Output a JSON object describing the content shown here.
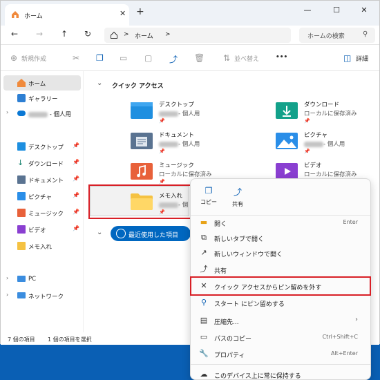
{
  "tab": {
    "title": "ホーム",
    "close": "✕",
    "new": "+"
  },
  "window_controls": {
    "min": "—",
    "max": "☐",
    "close": "✕"
  },
  "nav": {
    "back": "←",
    "forward": "→",
    "up": "↑",
    "refresh": "↻"
  },
  "address": {
    "sep1": ">",
    "crumb": "ホーム",
    "sep2": ">"
  },
  "search": {
    "placeholder": "ホームの検索"
  },
  "toolbar": {
    "new": "新規作成",
    "sort": "並べ替え",
    "more": "•••",
    "details": "詳細"
  },
  "sidebar": {
    "items": [
      {
        "label": "ホーム"
      },
      {
        "label": "ギャラリー"
      },
      {
        "label": "- 個人用"
      },
      {
        "label": "デスクトップ"
      },
      {
        "label": "ダウンロード"
      },
      {
        "label": "ドキュメント"
      },
      {
        "label": "ピクチャ"
      },
      {
        "label": "ミュージック"
      },
      {
        "label": "ビデオ"
      },
      {
        "label": "メモ入れ"
      },
      {
        "label": "PC"
      },
      {
        "label": "ネットワーク"
      }
    ]
  },
  "quick_access": {
    "title": "クイック アクセス",
    "folders": [
      {
        "name": "デスクトップ",
        "sub": "- 個人用"
      },
      {
        "name": "ダウンロード",
        "sub": "ローカルに保存済み"
      },
      {
        "name": "ドキュメント",
        "sub": "- 個人用"
      },
      {
        "name": "ピクチャ",
        "sub": "- 個人用"
      },
      {
        "name": "ミュージック",
        "sub": "ローカルに保存済み"
      },
      {
        "name": "ビデオ",
        "sub": "ローカルに保存済み"
      },
      {
        "name": "メモ入れ",
        "sub": "- 個"
      }
    ]
  },
  "recent": {
    "label": "最近使用した項目"
  },
  "status": {
    "count": "7 個の項目",
    "selected": "1 個の項目を選択"
  },
  "context_menu": {
    "copy": "コピー",
    "share_top": "共有",
    "items": [
      {
        "label": "開く",
        "shortcut": "Enter"
      },
      {
        "label": "新しいタブで開く",
        "shortcut": ""
      },
      {
        "label": "新しいウィンドウで開く",
        "shortcut": ""
      },
      {
        "label": "共有",
        "shortcut": ""
      },
      {
        "label": "クイック アクセスからピン留めを外す",
        "shortcut": ""
      },
      {
        "label": "スタート にピン留めする",
        "shortcut": ""
      },
      {
        "label": "圧縮先...",
        "shortcut": ""
      },
      {
        "label": "パスのコピー",
        "shortcut": "Ctrl+Shift+C"
      },
      {
        "label": "プロパティ",
        "shortcut": "Alt+Enter"
      },
      {
        "label": "このデバイス上に常に保持する",
        "shortcut": ""
      }
    ]
  },
  "colors": {
    "accent": "#0067c0",
    "highlight": "#d81f26",
    "folder": "#f5c242"
  }
}
